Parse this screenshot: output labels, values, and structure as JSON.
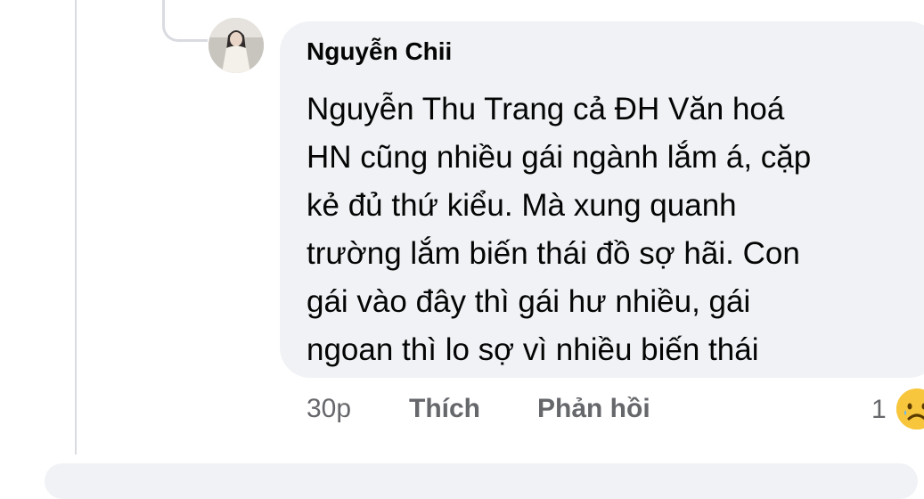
{
  "comment": {
    "author": "Nguyễn Chii",
    "text_lines": [
      "Nguyễn Thu Trang cả ĐH Văn hoá",
      "HN cũng nhiều gái ngành lắm á, cặp",
      "kẻ đủ thứ kiểu. Mà xung quanh",
      "trường lắm biến thái đồ sợ hãi. Con",
      "gái vào đây thì gái hư nhiều, gái",
      "ngoan thì lo sợ vì nhiều biến thái"
    ],
    "time": "30p",
    "like_label": "Thích",
    "reply_label": "Phản hồi",
    "reaction_count": "1",
    "reaction_icon": "sad-face-icon"
  },
  "colors": {
    "bubble": "#f0f2f5",
    "text": "#050505",
    "meta": "#65676b",
    "reaction": "#f7c63d"
  }
}
